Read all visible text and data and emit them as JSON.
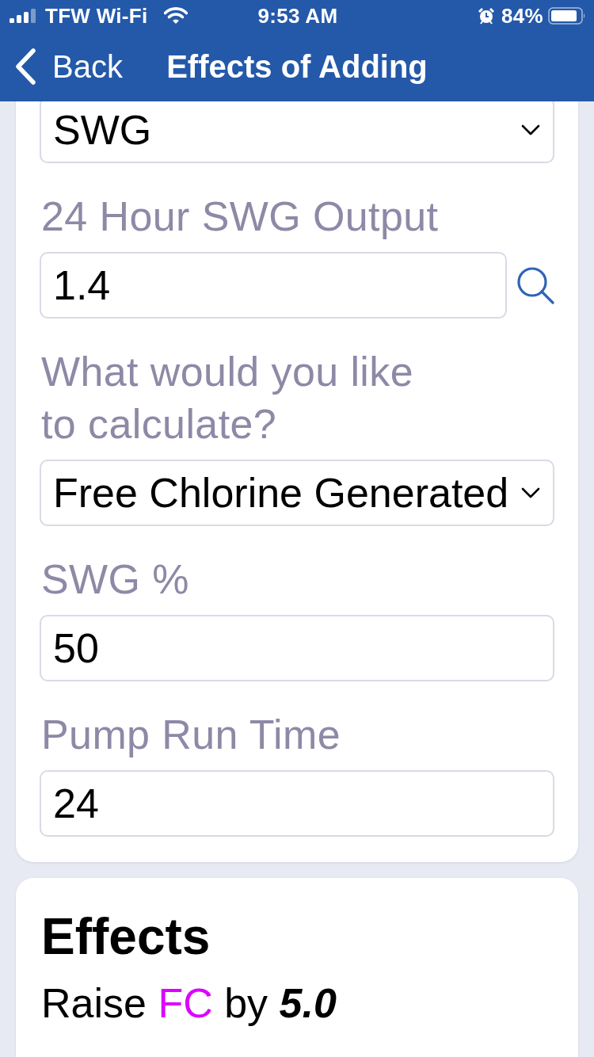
{
  "status_bar": {
    "carrier": "TFW Wi-Fi",
    "time": "9:53 AM",
    "battery": "84%"
  },
  "nav_bar": {
    "back": "Back",
    "title": "Effects of Adding"
  },
  "form": {
    "fields": [
      {
        "kind": "select",
        "value": "SWG"
      },
      {
        "kind": "input",
        "label": "24 Hour SWG Output",
        "value": "1.4",
        "lookup": true
      },
      {
        "kind": "select",
        "label": "What would you like to calculate?",
        "value": "Free Chlorine Generated"
      },
      {
        "kind": "input",
        "label": "SWG %",
        "value": "50"
      },
      {
        "kind": "input",
        "label": "Pump Run Time",
        "value": "24"
      }
    ]
  },
  "effects": {
    "title": "Effects",
    "lines": [
      {
        "action": "Raise",
        "parameter": "FC",
        "color": "#dc00ff",
        "connector": "by",
        "amount": "5.0"
      }
    ]
  }
}
